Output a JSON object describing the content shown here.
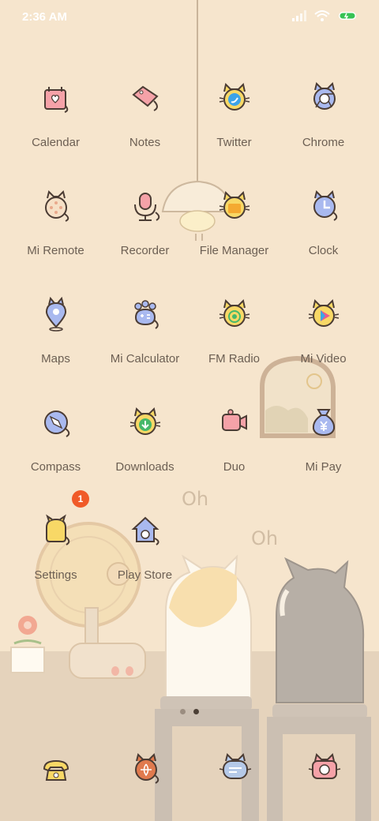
{
  "status_bar": {
    "time": "2:36 AM"
  },
  "apps": [
    {
      "label": "Calendar",
      "icon": "calendar-icon"
    },
    {
      "label": "Notes",
      "icon": "notes-icon"
    },
    {
      "label": "Twitter",
      "icon": "twitter-icon"
    },
    {
      "label": "Chrome",
      "icon": "chrome-icon"
    },
    {
      "label": "Mi Remote",
      "icon": "remote-icon"
    },
    {
      "label": "Recorder",
      "icon": "recorder-icon"
    },
    {
      "label": "File Manager",
      "icon": "folder-icon"
    },
    {
      "label": "Clock",
      "icon": "clock-icon"
    },
    {
      "label": "Maps",
      "icon": "map-pin-icon"
    },
    {
      "label": "Mi Calculator",
      "icon": "calculator-icon"
    },
    {
      "label": "FM Radio",
      "icon": "radio-icon"
    },
    {
      "label": "Mi Video",
      "icon": "video-play-icon"
    },
    {
      "label": "Compass",
      "icon": "compass-icon"
    },
    {
      "label": "Downloads",
      "icon": "download-icon"
    },
    {
      "label": "Duo",
      "icon": "video-camera-icon"
    },
    {
      "label": "Mi Pay",
      "icon": "money-bag-icon"
    },
    {
      "label": "Settings",
      "icon": "settings-icon",
      "badge": "1"
    },
    {
      "label": "Play Store",
      "icon": "play-store-icon"
    }
  ],
  "dock": [
    {
      "name": "phone",
      "icon": "phone-icon"
    },
    {
      "name": "browser",
      "icon": "browser-icon"
    },
    {
      "name": "messages",
      "icon": "messages-icon"
    },
    {
      "name": "camera",
      "icon": "camera-icon"
    }
  ],
  "wallpaper_text": [
    "Oh",
    "Oh"
  ],
  "colors": {
    "wall": "#f6e5cd",
    "floor": "#e5d3bc",
    "label": "#6c5f53",
    "badge": "#f05a28"
  }
}
